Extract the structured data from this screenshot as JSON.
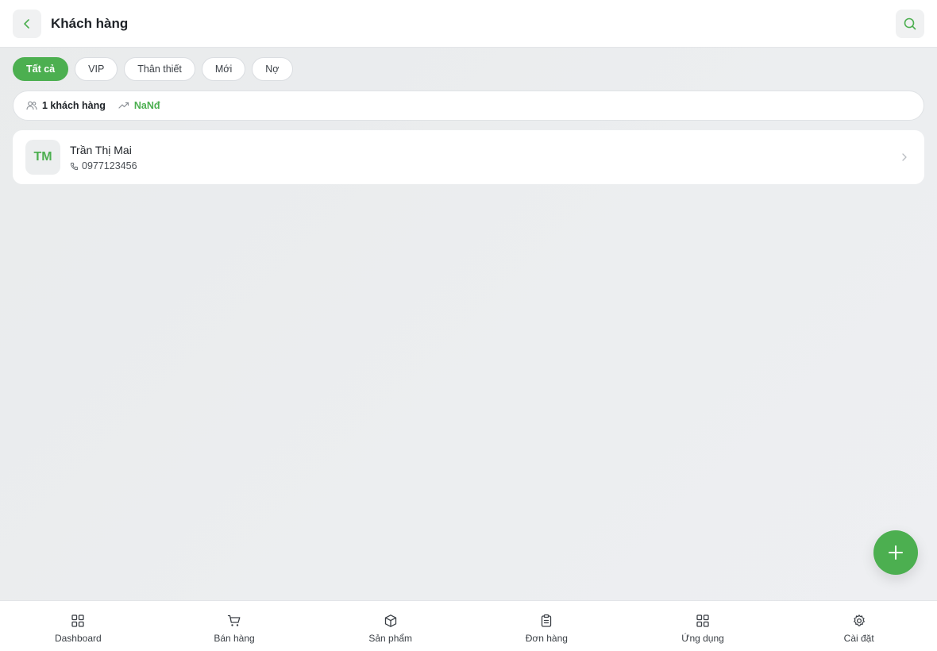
{
  "header": {
    "title": "Khách hàng",
    "back_icon": "chevron-left-icon",
    "search_icon": "search-icon"
  },
  "filters": [
    {
      "label": "Tất cả",
      "active": true
    },
    {
      "label": "VIP",
      "active": false
    },
    {
      "label": "Thân thiết",
      "active": false
    },
    {
      "label": "Mới",
      "active": false
    },
    {
      "label": "Nợ",
      "active": false
    }
  ],
  "stats": {
    "customer_count": "1 khách hàng",
    "total_value": "NaNđ"
  },
  "customers": [
    {
      "initials": "TM",
      "name": "Trần Thị Mai",
      "phone": "0977123456"
    }
  ],
  "nav": [
    {
      "label": "Dashboard",
      "icon": "grid-icon"
    },
    {
      "label": "Bán hàng",
      "icon": "cart-icon"
    },
    {
      "label": "Sản phẩm",
      "icon": "box-icon"
    },
    {
      "label": "Đơn hàng",
      "icon": "clipboard-icon"
    },
    {
      "label": "Ứng dụng",
      "icon": "apps-icon"
    },
    {
      "label": "Cài đặt",
      "icon": "gear-icon"
    }
  ],
  "colors": {
    "accent": "#4caf50",
    "background": "#eceef0",
    "surface": "#ffffff"
  }
}
